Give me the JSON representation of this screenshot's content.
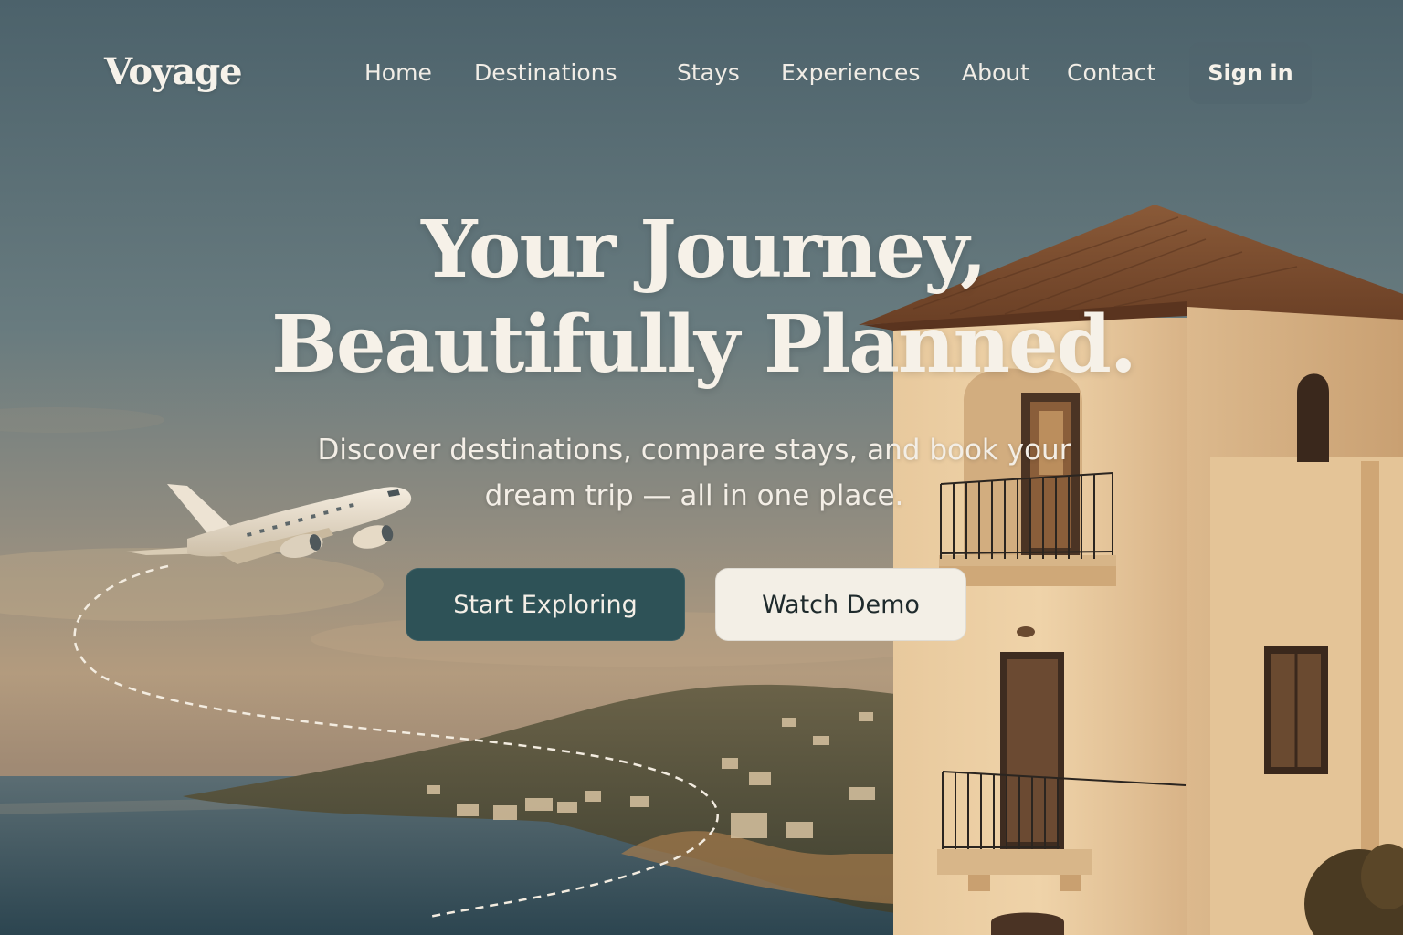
{
  "nav": {
    "brand": "Voyage",
    "links": [
      "Home",
      "Destinations",
      "Stays",
      "Experiences",
      "About",
      "Contact"
    ],
    "signin_label": "Sign in"
  },
  "hero": {
    "headline_line1": "Your Journey,",
    "headline_line2": "Beautifully Planned.",
    "subtext_line1": "Discover destinations, compare stays, and book your",
    "subtext_line2": "dream trip — all in one place.",
    "primary_cta": "Start Exploring",
    "secondary_cta": "Watch Demo"
  },
  "colors": {
    "primary_button": "#2e5257",
    "secondary_button": "#f3efe6",
    "headline_text": "#f6f1e8"
  },
  "illustration": {
    "icons": [
      "airplane-icon",
      "flight-path",
      "villa-building",
      "coastal-hills",
      "sea"
    ]
  }
}
